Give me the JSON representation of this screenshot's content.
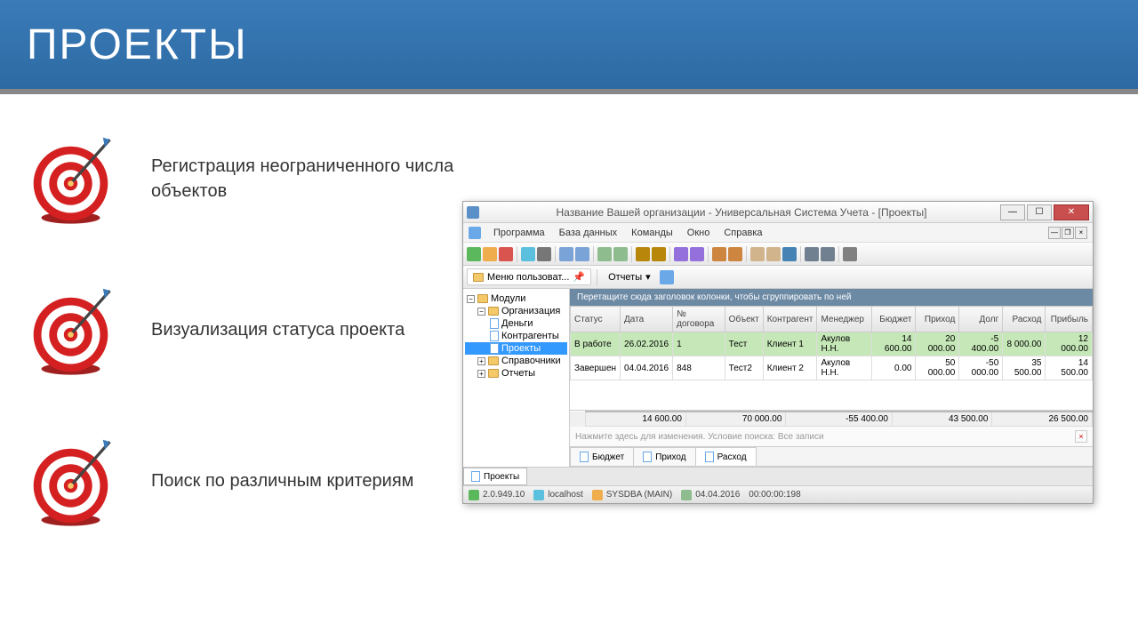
{
  "slide": {
    "title": "ПРОЕКТЫ",
    "features": [
      "Регистрация неограниченного числа объектов",
      "Визуализация статуса проекта",
      "Поиск по различным критериям"
    ]
  },
  "app": {
    "title": "Название Вашей организации - Универсальная Система Учета - [Проекты]",
    "menu": [
      "Программа",
      "База данных",
      "Команды",
      "Окно",
      "Справка"
    ],
    "user_menu_btn": "Меню пользоват...",
    "reports_btn": "Отчеты",
    "group_hint": "Перетащите сюда заголовок колонки, чтобы сгруппировать по ней",
    "filter_hint": "Нажмите здесь для изменения. Условие поиска: Все записи",
    "tree": {
      "root": "Модули",
      "org": "Организация",
      "org_children": [
        "Деньги",
        "Контрагенты",
        "Проекты"
      ],
      "refs": "Справочники",
      "reports": "Отчеты"
    },
    "columns": [
      "Статус",
      "Дата",
      "№ договора",
      "Объект",
      "Контрагент",
      "Менеджер",
      "Бюджет",
      "Приход",
      "Долг",
      "Расход",
      "Прибыль"
    ],
    "rows": [
      {
        "status": "В работе",
        "date": "26.02.2016",
        "num": "1",
        "obj": "Тест",
        "contr": "Клиент 1",
        "mgr": "Акулов Н.Н.",
        "budget": "14 600.00",
        "in": "20 000.00",
        "debt": "-5 400.00",
        "out": "8 000.00",
        "profit": "12 000.00"
      },
      {
        "status": "Завершен",
        "date": "04.04.2016",
        "num": "848",
        "obj": "Тест2",
        "contr": "Клиент 2",
        "mgr": "Акулов Н.Н.",
        "budget": "0.00",
        "in": "50 000.00",
        "debt": "-50 000.00",
        "out": "35 500.00",
        "profit": "14 500.00"
      }
    ],
    "totals": {
      "budget": "14 600.00",
      "in": "70 000.00",
      "debt": "-55 400.00",
      "out": "43 500.00",
      "profit": "26 500.00"
    },
    "subtabs": [
      "Бюджет",
      "Приход",
      "Расход"
    ],
    "bottom_tab": "Проекты",
    "status": {
      "version": "2.0.949.10",
      "host": "localhost",
      "user": "SYSDBA (MAIN)",
      "date": "04.04.2016",
      "time": "00:00:00:198"
    }
  }
}
